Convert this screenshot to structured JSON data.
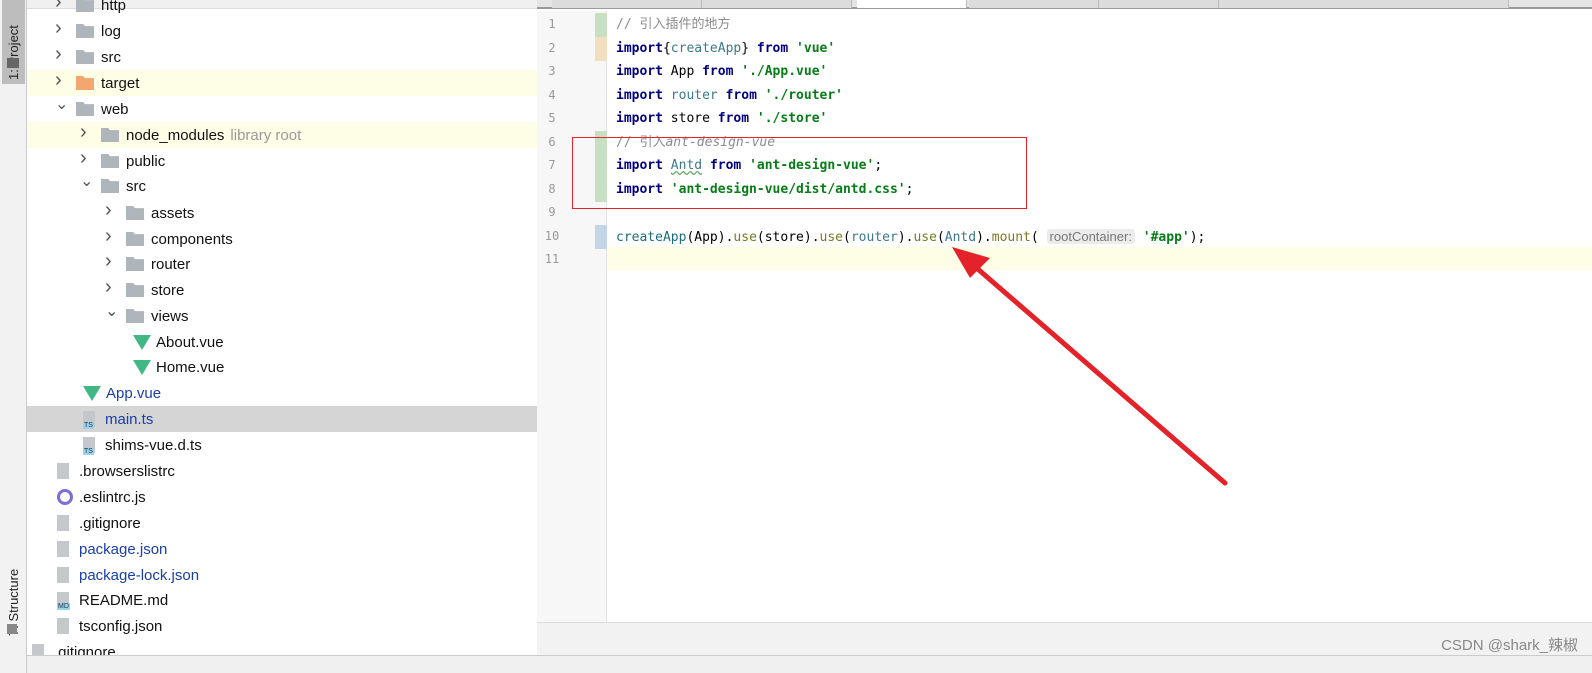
{
  "tool_windows": {
    "project": "1: Project",
    "structure": "7: Structure"
  },
  "tree": [
    {
      "label": "http",
      "type": "folder",
      "level": 0,
      "arrow": "right"
    },
    {
      "label": "log",
      "type": "folder",
      "level": 0,
      "arrow": "right"
    },
    {
      "label": "src",
      "type": "folder",
      "level": 0,
      "arrow": "right"
    },
    {
      "label": "target",
      "type": "folder-orange",
      "level": 0,
      "arrow": "right",
      "highlight": true
    },
    {
      "label": "web",
      "type": "folder",
      "level": 0,
      "arrow": "down"
    },
    {
      "label": "node_modules",
      "suffix": "library root",
      "type": "folder",
      "level": 1,
      "arrow": "right",
      "highlight": true
    },
    {
      "label": "public",
      "type": "folder",
      "level": 1,
      "arrow": "right"
    },
    {
      "label": "src",
      "type": "folder",
      "level": 1,
      "arrow": "down"
    },
    {
      "label": "assets",
      "type": "folder",
      "level": 2,
      "arrow": "right"
    },
    {
      "label": "components",
      "type": "folder",
      "level": 2,
      "arrow": "right"
    },
    {
      "label": "router",
      "type": "folder",
      "level": 2,
      "arrow": "right"
    },
    {
      "label": "store",
      "type": "folder",
      "level": 2,
      "arrow": "right"
    },
    {
      "label": "views",
      "type": "folder",
      "level": 2,
      "arrow": "down"
    },
    {
      "label": "About.vue",
      "type": "vue",
      "level": 3
    },
    {
      "label": "Home.vue",
      "type": "vue",
      "level": 3
    },
    {
      "label": "App.vue",
      "type": "vue",
      "level": 2,
      "blue": true
    },
    {
      "label": "main.ts",
      "type": "ts",
      "level": 2,
      "blue": true,
      "selected": true
    },
    {
      "label": "shims-vue.d.ts",
      "type": "ts",
      "level": 2
    },
    {
      "label": ".browserslistrc",
      "type": "file",
      "level": 1
    },
    {
      "label": ".eslintrc.js",
      "type": "eslint",
      "level": 1
    },
    {
      "label": ".gitignore",
      "type": "file",
      "level": 1
    },
    {
      "label": "package.json",
      "type": "json",
      "level": 1,
      "blue": true
    },
    {
      "label": "package-lock.json",
      "type": "json",
      "level": 1,
      "blue": true
    },
    {
      "label": "README.md",
      "type": "md",
      "level": 1
    },
    {
      "label": "tsconfig.json",
      "type": "json",
      "level": 1
    },
    {
      "label": ".gitignore",
      "type": "file",
      "level": 0
    }
  ],
  "editor": {
    "lines": [
      [
        [
          "cm",
          "// 引入插件的地方"
        ]
      ],
      [
        [
          "kw",
          "import"
        ],
        [
          "",
          "{"
        ],
        [
          "id",
          "createApp"
        ],
        [
          "",
          "} "
        ],
        [
          "kw",
          "from"
        ],
        [
          "str",
          " 'vue'"
        ]
      ],
      [
        [
          "kw",
          "import"
        ],
        [
          "",
          " App "
        ],
        [
          "kw",
          "from"
        ],
        [
          "str",
          " './App.vue'"
        ]
      ],
      [
        [
          "kw",
          "import"
        ],
        [
          "id",
          " router "
        ],
        [
          "kw",
          "from"
        ],
        [
          "str",
          " './router'"
        ]
      ],
      [
        [
          "kw",
          "import"
        ],
        [
          "",
          " store "
        ],
        [
          "kw",
          "from"
        ],
        [
          "str",
          " './store'"
        ]
      ],
      [
        [
          "cm",
          "// 引入"
        ],
        [
          "cmi",
          "ant-design-vue"
        ]
      ],
      [
        [
          "kw",
          "import"
        ],
        [
          "",
          "",
          " "
        ],
        [
          "wavy",
          "Antd"
        ],
        [
          "",
          " "
        ],
        [
          "kw",
          "from"
        ],
        [
          "str",
          " 'ant-design-vue'"
        ],
        [
          "",
          ";"
        ]
      ],
      [
        [
          "kw",
          "import"
        ],
        [
          "str",
          " 'ant-design-vue/dist/antd.css'"
        ],
        [
          "",
          ";"
        ]
      ],
      [],
      [
        [
          "fn",
          "createApp"
        ],
        [
          "",
          "(App)."
        ],
        [
          "meth",
          "use"
        ],
        [
          "",
          "(store)."
        ],
        [
          "meth",
          "use"
        ],
        [
          "",
          "("
        ],
        [
          "id",
          "router"
        ],
        [
          "",
          ")."
        ],
        [
          "meth",
          "use"
        ],
        [
          "",
          "("
        ],
        [
          "id",
          "Antd"
        ],
        [
          "",
          ")."
        ],
        [
          "meth",
          "mount"
        ],
        [
          "",
          "( "
        ],
        [
          "hint",
          "rootContainer:"
        ],
        [
          "str",
          " '#app'"
        ],
        [
          "",
          ");"
        ]
      ],
      []
    ],
    "line_numbers": [
      "1",
      "2",
      "3",
      "4",
      "5",
      "6",
      "7",
      "8",
      "9",
      "10",
      "11"
    ],
    "current_line": "11"
  },
  "annotation_color": "#e3222a",
  "watermark": "CSDN @shark_辣椒"
}
